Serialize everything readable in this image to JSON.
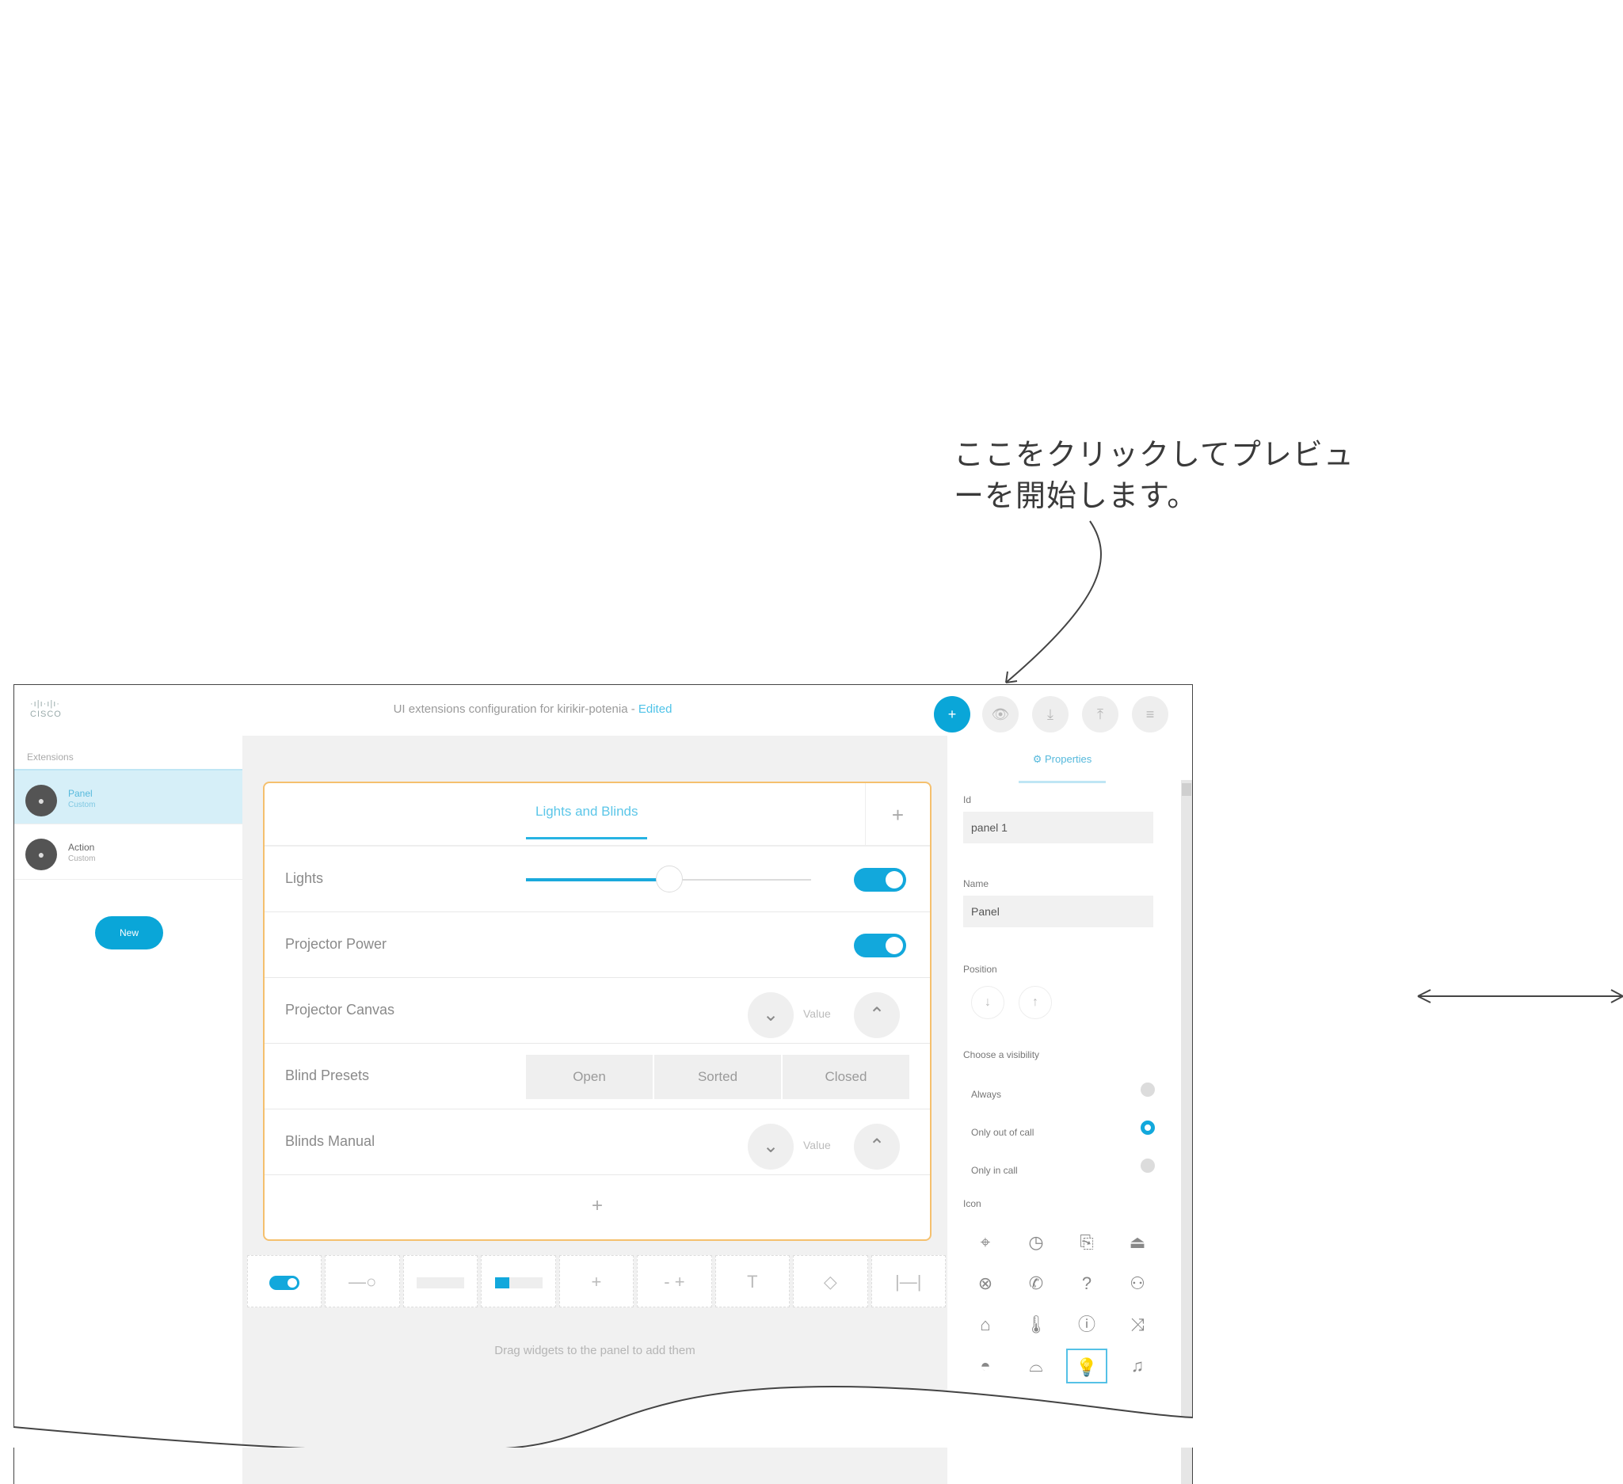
{
  "callout": {
    "line1": "ここをクリックしてプレビュ",
    "line2": "ーを開始します。"
  },
  "app": {
    "logo_top": "·ı|ı·ı|ı·",
    "logo_bottom": "CISCO",
    "title": "UI extensions configuration for kirikir-potenia -",
    "title_status": "Edited",
    "toolbar": {
      "primary_label": "+",
      "preview_label": "👁",
      "download_label": "⤓",
      "upload_label": "⤒",
      "menu_label": "≡"
    }
  },
  "sidebar": {
    "header": "Extensions",
    "items": [
      {
        "name": "Panel",
        "sub": "Custom"
      },
      {
        "name": "Action",
        "sub": "Custom"
      }
    ],
    "new_label": "New"
  },
  "panel": {
    "tab": "Lights and Blinds",
    "add_label": "+",
    "rows": [
      {
        "label": "Lights",
        "widget": "slider+toggle",
        "slider_value": 0.5,
        "toggle_on": true
      },
      {
        "label": "Projector Power",
        "widget": "toggle",
        "toggle_on": true
      },
      {
        "label": "Projector Canvas",
        "widget": "spinner",
        "value": "Value"
      },
      {
        "label": "Blind Presets",
        "widget": "buttons",
        "buttons": [
          "Open",
          "Sorted",
          "Closed"
        ]
      },
      {
        "label": "Blinds Manual",
        "widget": "spinner",
        "value": "Value"
      }
    ],
    "add_row_label": "+"
  },
  "palette": {
    "items": [
      "toggle",
      "slider",
      "text-field",
      "progress",
      "+",
      "- +",
      "T",
      "◇",
      "|—|"
    ],
    "hint": "Drag widgets to the panel to add them"
  },
  "properties": {
    "tab": "⚙ Properties",
    "id_label": "Id",
    "id_value": "panel 1",
    "name_label": "Name",
    "name_value": "Panel",
    "position_label": "Position",
    "visibility_label": "Choose a visibility",
    "visibility_options": [
      {
        "label": "Always",
        "selected": false
      },
      {
        "label": "Only out of call",
        "selected": true
      },
      {
        "label": "Only in call",
        "selected": false
      }
    ],
    "icon_label": "Icon",
    "icons": [
      "⌖",
      "◷",
      "⎘",
      "⏏",
      "⊗",
      "✆",
      "?",
      "⚇",
      "⌂",
      "🌡",
      "ⓘ",
      "⤨",
      "◓",
      "⌓",
      "💡",
      "♫"
    ],
    "selected_icon_index": 14
  }
}
